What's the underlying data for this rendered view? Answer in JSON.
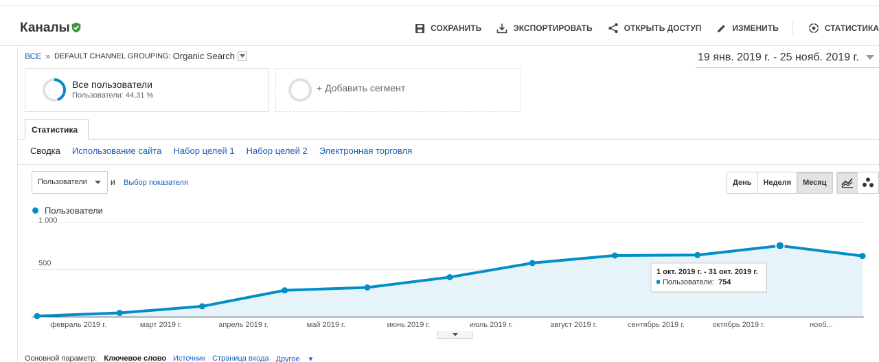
{
  "header": {
    "title": "Каналы",
    "actions": {
      "save": "СОХРАНИТЬ",
      "export": "ЭКСПОРТИРОВАТЬ",
      "share": "ОТКРЫТЬ ДОСТУП",
      "edit": "ИЗМЕНИТЬ",
      "insights": "СТАТИСТИКА"
    }
  },
  "breadcrumb": {
    "root": "ВСЕ",
    "separator": "»",
    "grouping": "DEFAULT CHANNEL GROUPING:",
    "value": "Organic Search"
  },
  "date_range": "19 янв. 2019 г. - 25 нояб. 2019 г.",
  "segments": {
    "active": {
      "title": "Все пользователи",
      "subtitle": "Пользователи: 44,31 %",
      "share": 0.4431
    },
    "add_label": "+ Добавить сегмент"
  },
  "tab": {
    "label": "Статистика"
  },
  "subnav": {
    "items": [
      "Сводка",
      "Использование сайта",
      "Набор целей 1",
      "Набор целей 2",
      "Электронная торговля"
    ]
  },
  "controls": {
    "metric_selected": "Пользователи",
    "and_label": "и",
    "metric_link": "Выбор показателя",
    "periods": [
      "День",
      "Неделя",
      "Месяц"
    ],
    "active_period": "Месяц"
  },
  "colors": {
    "series": "#058dc7",
    "area": "#e6f4fa",
    "link": "#1a5eb8",
    "verified": "#3a9a3a"
  },
  "chart_data": {
    "type": "line",
    "series": [
      {
        "name": "Пользователи",
        "values": [
          6,
          40,
          110,
          280,
          310,
          420,
          570,
          650,
          655,
          754,
          645
        ]
      }
    ],
    "x_ticks": [
      "февраль 2019 г.",
      "март 2019 г.",
      "апрель 2019 г.",
      "май 2019 г.",
      "июнь 2019 г.",
      "июль 2019 г.",
      "август 2019 г.",
      "сентябрь 2019 г.",
      "октябрь 2019 г.",
      "нояб..."
    ],
    "y_ticks": [
      "1 000",
      "500"
    ],
    "ylim": [
      0,
      1000
    ],
    "tooltip": {
      "title": "1 окт. 2019 г. - 31 окт. 2019 г.",
      "label": "Пользователи:",
      "value": "754"
    }
  },
  "primary_dimension": {
    "label": "Основной параметр:",
    "current": "Ключевое слово",
    "options": [
      "Источник",
      "Страница входа"
    ],
    "other": "Другое"
  }
}
